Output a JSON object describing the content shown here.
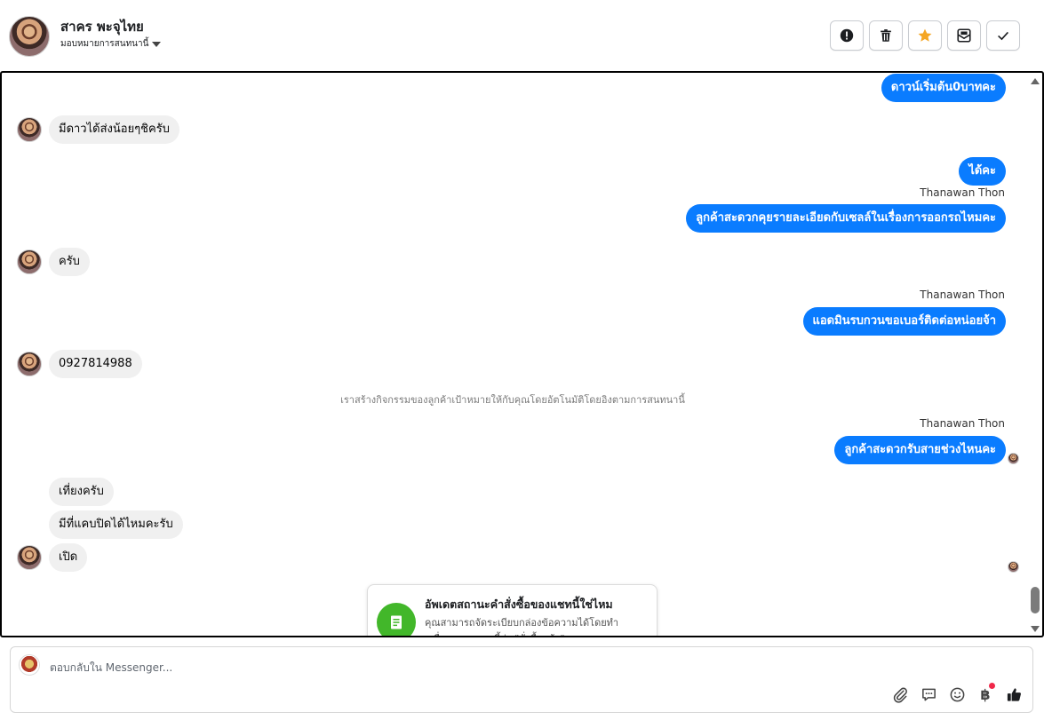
{
  "header": {
    "contact_name": "สาคร พะจุไทย",
    "assign_label": "มอบหมายการสนทนานี้"
  },
  "messages": {
    "out_top": "ดาวน์เริ่มต้น0บาทคะ",
    "in_1": "มีดาวได้ส่งน้อยๆชิครับ",
    "out_1": "ได้คะ",
    "sender_1": "Thanawan Thon",
    "out_2": "ลูกค้าสะดวกคุยรายละเอียดกับเซลล์ในเรื่องการออกรถไหมคะ",
    "in_2": "ครับ",
    "sender_2": "Thanawan Thon",
    "out_3": "แอดมินรบกวนขอเบอร์ติดต่อหน่อยจ้า",
    "in_3": "0927814988",
    "system_note": "เราสร้างกิจกรรมของลูกค้าเป้าหมายให้กับคุณโดยอัตโนมัติโดยอิงตามการสนทนานี้",
    "sender_3": "Thanawan Thon",
    "out_4": "ลูกค้าสะดวกรับสายช่วงไหนคะ",
    "in_4a": "เที่ยงครับ",
    "in_4b": "มีที่แคบปิดได้ไหมคะรับ",
    "in_4c": "เปิด"
  },
  "prompt_card": {
    "title": "อัพเดตสถานะคำสั่งซื้อของแชทนี้ใช่ไหม",
    "description": "คุณสามารถจัดระเบียบกล่องข้อความได้โดยทำเครื่องหมายแชทนี้ว่า \"สั่งซื้อแล้ว\""
  },
  "composer": {
    "placeholder": "ตอบกลับใน Messenger...",
    "currency_symbol": "฿"
  },
  "colors": {
    "outgoing_bubble": "#0a7cff",
    "incoming_bubble": "#f0f0f0",
    "star": "#f5a623",
    "prompt_icon": "#42b72a"
  },
  "icons": {
    "actions": [
      "alert-icon",
      "trash-icon",
      "star-icon",
      "mark-unread-icon",
      "check-icon"
    ],
    "composer": [
      "attachment-icon",
      "saved-reply-icon",
      "emoji-icon",
      "baht-icon",
      "like-icon"
    ]
  }
}
